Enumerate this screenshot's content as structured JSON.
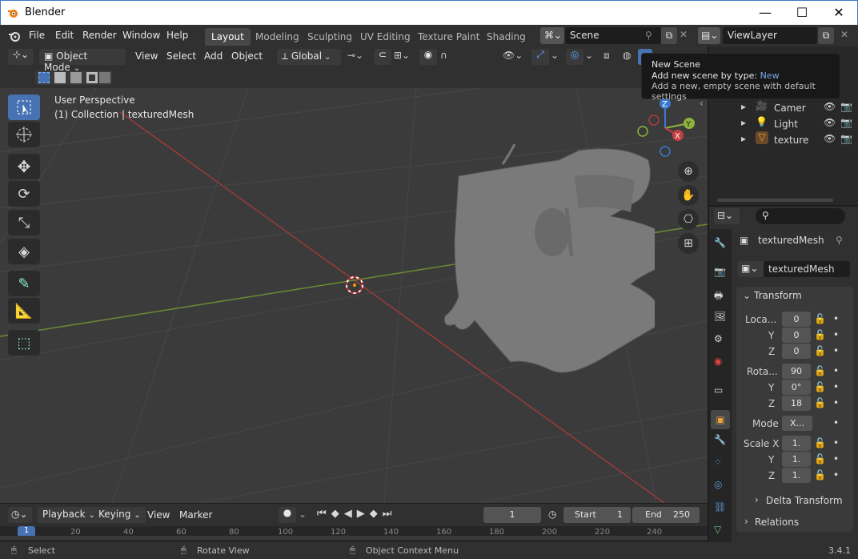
{
  "window": {
    "title": "Blender",
    "min": "—",
    "max": "☐",
    "close": "✕"
  },
  "menu": {
    "items": [
      "File",
      "Edit",
      "Render",
      "Window",
      "Help"
    ]
  },
  "workspaces": {
    "tabs": [
      "Layout",
      "Modeling",
      "Sculpting",
      "UV Editing",
      "Texture Paint",
      "Shading"
    ],
    "active": "Layout"
  },
  "scene": {
    "name": "Scene",
    "view_layer": "ViewLayer"
  },
  "viewport_header": {
    "mode": "Object Mode",
    "menus": [
      "View",
      "Select",
      "Add",
      "Object"
    ],
    "orientation": "Global"
  },
  "viewport": {
    "perspective": "User Perspective",
    "collection": "(1) Collection | texturedMesh"
  },
  "gizmo": {
    "z": "Z",
    "y": "Y",
    "x": "X"
  },
  "tooltip": {
    "title": "New Scene",
    "line1_prefix": "Add new scene by type:",
    "line1_value": "New",
    "line2": "Add a new, empty scene with default settings"
  },
  "outliner": {
    "items": [
      "Camer",
      "Light",
      "texture"
    ]
  },
  "properties": {
    "object_name": "texturedMesh",
    "data_name": "texturedMesh",
    "transform_label": "Transform",
    "location": {
      "label": "Loca...",
      "x": "0",
      "y": "0",
      "z": "0"
    },
    "rotation": {
      "label": "Rota...",
      "x": "90",
      "y": "0°",
      "z": "18"
    },
    "mode": {
      "label": "Mode",
      "value": "X..."
    },
    "scale": {
      "label": "Scale X",
      "x": "1.",
      "y": "1.",
      "z": "1."
    },
    "axis_y": "Y",
    "axis_z": "Z",
    "delta_transform": "Delta Transform",
    "relations": "Relations"
  },
  "timeline": {
    "menus": [
      "Playback",
      "Keying",
      "View",
      "Marker"
    ],
    "current_frame": "1",
    "start_label": "Start",
    "start": "1",
    "end_label": "End",
    "end": "250",
    "ruler": [
      "1",
      "20",
      "40",
      "60",
      "80",
      "100",
      "120",
      "140",
      "160",
      "180",
      "200",
      "220",
      "240"
    ]
  },
  "statusbar": {
    "select": "Select",
    "rotate": "Rotate View",
    "context": "Object Context Menu",
    "version": "3.4.1"
  },
  "colors": {
    "accent": "#4772b3",
    "x_axis": "#c44040",
    "y_axis": "#8cb43c",
    "z_axis": "#3a78d0"
  }
}
